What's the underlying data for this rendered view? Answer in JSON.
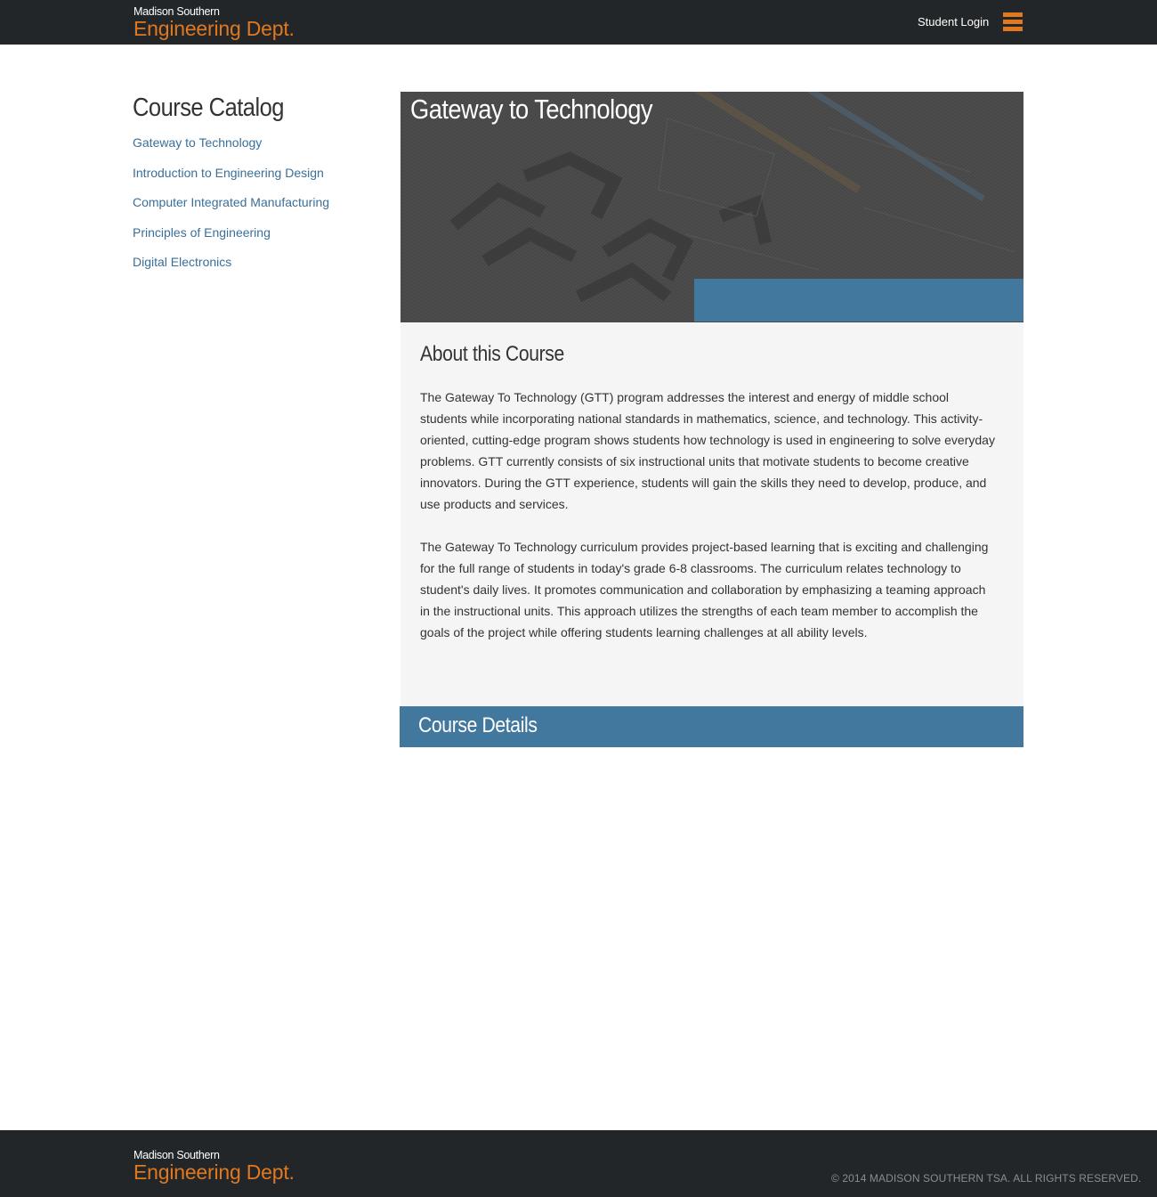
{
  "header": {
    "logo_small": "Madison Southern",
    "logo_big": "Engineering Dept.",
    "login_label": "Student Login",
    "menu_icon": "hamburger-icon"
  },
  "sidebar": {
    "title": "Course Catalog",
    "items": [
      {
        "label": "Gateway to Technology"
      },
      {
        "label": "Introduction to Engineering Design"
      },
      {
        "label": "Computer Integrated Manufacturing"
      },
      {
        "label": "Principles of Engineering"
      },
      {
        "label": "Digital Electronics"
      }
    ]
  },
  "hero": {
    "title": "Gateway to Technology"
  },
  "about": {
    "heading": "About this Course",
    "paragraph1": "The Gateway To Technology (GTT) program addresses the interest and energy of middle school students while incorporating national standards in mathematics, science, and technology. This activity-oriented, cutting-edge program shows students how technology is used in engineering to solve everyday problems. GTT currently consists of six instructional units that motivate students to become creative innovators. During the GTT experience, students will gain the skills they need to develop, produce, and use products and services.",
    "paragraph2": "The Gateway To Technology curriculum provides project-based learning that is exciting and challenging for the full range of students in today's grade 6-8 classrooms. The curriculum relates technology to student's daily lives. It promotes communication and collaboration by emphasizing a teaming approach in the instructional units. This approach utilizes the strengths of each team member to accomplish the goals of the project while offering students learning challenges at all ability levels."
  },
  "details": {
    "heading": "Course Details"
  },
  "footer": {
    "logo_small": "Madison Southern",
    "logo_big": "Engineering Dept.",
    "copyright": "© 2014 MADISON SOUTHERN TSA. ALL RIGHTS RESERVED."
  },
  "colors": {
    "header_bg": "#222629",
    "accent_orange": "#e0781f",
    "link_blue": "#3a6f99",
    "panel_blue": "#42789e",
    "about_bg": "#f5f5f5"
  }
}
